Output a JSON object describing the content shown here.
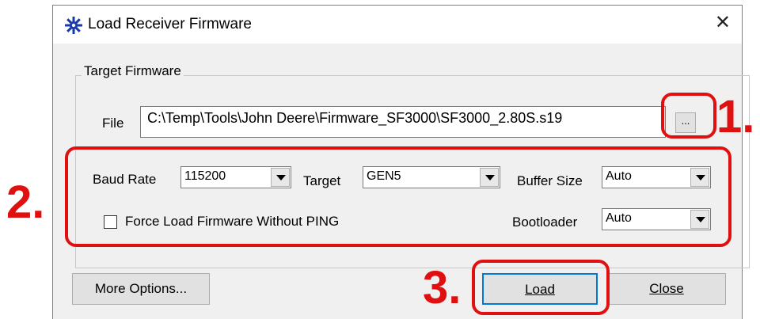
{
  "window": {
    "title": "Load Receiver Firmware",
    "icon": "gear-icon",
    "close_glyph": "✕"
  },
  "target_firmware": {
    "group_label": "Target Firmware",
    "file_label": "File",
    "file_value": "C:\\Temp\\Tools\\John Deere\\Firmware_SF3000\\SF3000_2.80S.s19",
    "browse_label": "..."
  },
  "settings": {
    "baud_rate_label": "Baud Rate",
    "baud_rate_value": "115200",
    "target_label": "Target",
    "target_value": "GEN5",
    "buffer_size_label": "Buffer Size",
    "buffer_size_value": "Auto",
    "force_load_label": "Force Load Firmware Without PING",
    "force_load_checked": false,
    "bootloader_label": "Bootloader",
    "bootloader_value": "Auto"
  },
  "buttons": {
    "more_options": "More Options...",
    "load": "Load",
    "close": "Close"
  },
  "annotations": {
    "step1": "1.",
    "step2": "2.",
    "step3": "3.",
    "color": "#e01010"
  }
}
